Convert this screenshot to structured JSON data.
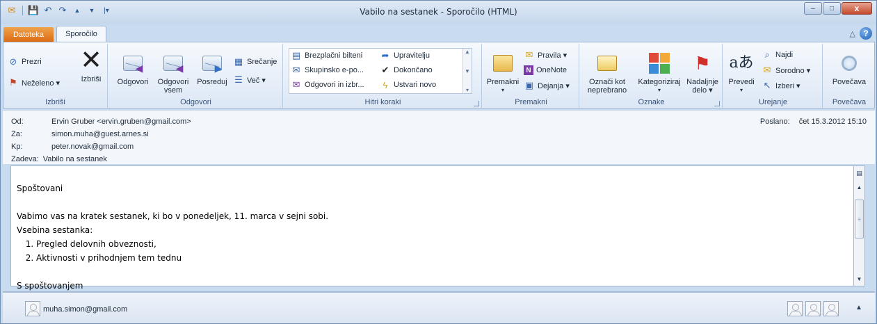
{
  "window": {
    "title": "Vabilo na sestanek - Sporočilo (HTML)",
    "controls": {
      "minimize": "–",
      "maximize": "□",
      "close": "x"
    }
  },
  "qat": {
    "save": "💾",
    "undo": "↶",
    "redo": "↷",
    "up": "▲",
    "down": "▼",
    "more": "|▾"
  },
  "tabs": {
    "file": "Datoteka",
    "message": "Sporočilo",
    "collapse": "△",
    "help": "?"
  },
  "ribbon": {
    "delete_group": {
      "label": "Izbriši",
      "ignore": "Prezri",
      "junk": "Neželeno ▾",
      "delete": "Izbriši"
    },
    "respond_group": {
      "label": "Odgovori",
      "reply": "Odgovori",
      "reply_all_line1": "Odgovori",
      "reply_all_line2": "vsem",
      "forward": "Posreduj",
      "meeting": "Srečanje",
      "more": "Več ▾"
    },
    "quicksteps_group": {
      "label": "Hitri koraki",
      "items": [
        "Brezplačni bilteni",
        "Upravitelju",
        "Skupinsko e-po...",
        "Dokončano",
        "Odgovori in izbr...",
        "Ustvari novo"
      ]
    },
    "move_group": {
      "label": "Premakni",
      "move": "Premakni",
      "move_arrow": "▾",
      "rules": "Pravila ▾",
      "onenote": "OneNote",
      "actions": "Dejanja ▾"
    },
    "tags_group": {
      "label": "Oznake",
      "unread_line1": "Označi kot",
      "unread_line2": "neprebrano",
      "categorize": "Kategoriziraj",
      "categorize_arrow": "▾",
      "followup_line1": "Nadaljnje",
      "followup_line2": "delo ▾"
    },
    "editing_group": {
      "label": "Urejanje",
      "translate": "Prevedi",
      "translate_arrow": "▾",
      "find": "Najdi",
      "related": "Sorodno ▾",
      "select": "Izberi ▾"
    },
    "zoom_group": {
      "label": "Povečava",
      "zoom": "Povečava"
    }
  },
  "header": {
    "from_label": "Od:",
    "from_value": "Ervin Gruber <ervin.gruben@gmail.com>",
    "to_label": "Za:",
    "to_value": "simon.muha@guest.arnes.si",
    "cc_label": "Kp:",
    "cc_value": "peter.novak@gmail.com",
    "subject_label": "Zadeva:",
    "subject_value": "Vabilo na sestanek",
    "sent_label": "Poslano:",
    "sent_value": "čet 15.3.2012 15:10"
  },
  "body": {
    "greeting": "Spoštovani",
    "line1": "Vabimo vas na kratek sestanek, ki bo v ponedeljek, 11. marca v sejni sobi.",
    "line2": "Vsebina sestanka:",
    "items": [
      "Pregled delovnih obveznosti,",
      "Aktivnosti v prihodnjem tem tednu"
    ],
    "closing": "S spoštovanjem"
  },
  "people": {
    "name": "muha.simon@gmail.com",
    "toggle": "▲"
  }
}
